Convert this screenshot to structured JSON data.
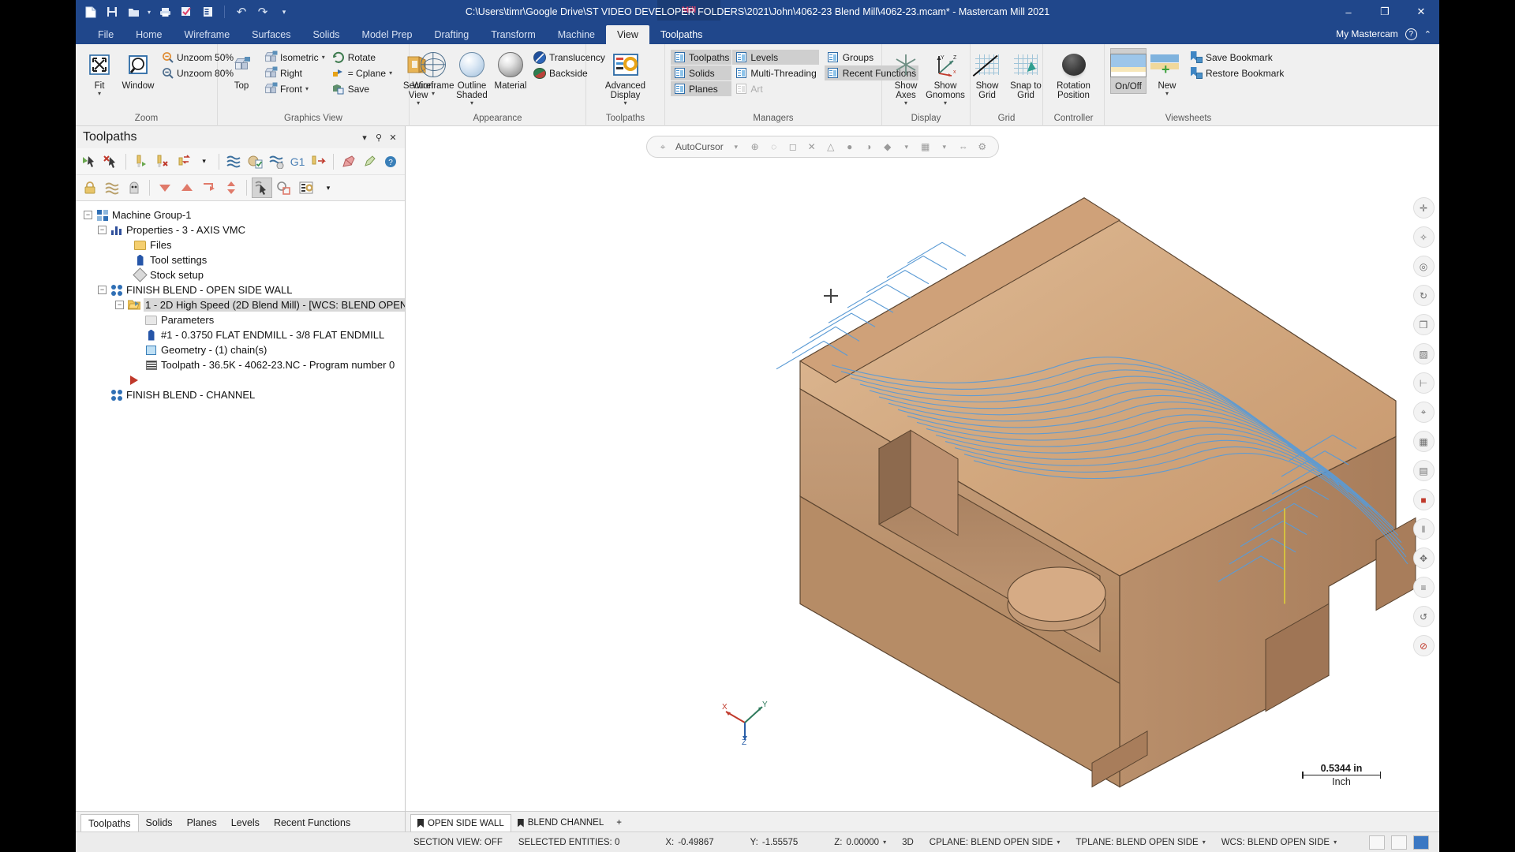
{
  "window": {
    "title": "C:\\Users\\timr\\Google Drive\\ST VIDEO DEVELOPER FOLDERS\\2021\\John\\4062-23 Blend Mill\\4062-23.mcam* - Mastercam Mill 2021",
    "product_badge": "Mill",
    "minimize": "–",
    "maximize": "❐",
    "close": "✕"
  },
  "quick_access": [
    {
      "name": "new-icon",
      "glyph": "❐"
    },
    {
      "name": "save-icon",
      "glyph": "὚B"
    },
    {
      "name": "open-icon",
      "glyph": "Ὄ1"
    },
    {
      "name": "print-icon",
      "glyph": "⎙"
    },
    {
      "name": "print-preview-icon",
      "glyph": "☑"
    },
    {
      "name": "import-icon",
      "glyph": "☰"
    },
    {
      "name": "undo-icon",
      "glyph": "↶"
    },
    {
      "name": "redo-icon",
      "glyph": "↷"
    },
    {
      "name": "customize-qat-icon",
      "glyph": "▾"
    }
  ],
  "ribbon": {
    "tabs": [
      "File",
      "Home",
      "Wireframe",
      "Surfaces",
      "Solids",
      "Model Prep",
      "Drafting",
      "Transform",
      "Machine",
      "View",
      "Toolpaths"
    ],
    "active_tab": "View",
    "my_mastercam": "My Mastercam",
    "help_glyph": "?",
    "collapse_glyph": "⌃",
    "groups": [
      {
        "label": "Zoom",
        "buttons": [
          {
            "name": "fit-button",
            "label": "Fit",
            "has_caret": true
          },
          {
            "name": "window-zoom-button",
            "label": "Window",
            "has_caret": false
          }
        ],
        "items": [
          {
            "name": "unzoom-50-button",
            "label": "Unzoom 50%"
          },
          {
            "name": "unzoom-80-button",
            "label": "Unzoom 80%"
          }
        ]
      },
      {
        "label": "Graphics View",
        "buttons": [
          {
            "name": "top-view-button",
            "label": "Top",
            "has_caret": false
          },
          {
            "name": "section-view-button",
            "label": "Section View",
            "has_caret": true
          }
        ],
        "col1": [
          {
            "name": "isometric-view-item",
            "label": "Isometric",
            "caret": true
          },
          {
            "name": "right-view-item",
            "label": "Right",
            "caret": false
          },
          {
            "name": "front-view-item",
            "label": "Front",
            "caret": true
          }
        ],
        "col2": [
          {
            "name": "rotate-item",
            "label": "Rotate",
            "caret": false
          },
          {
            "name": "equals-cplane-item",
            "label": "= Cplane",
            "caret": true
          },
          {
            "name": "save-view-item",
            "label": "Save",
            "caret": false
          }
        ]
      },
      {
        "label": "Appearance",
        "buttons": [
          {
            "name": "wireframe-button",
            "label": "Wireframe",
            "has_caret": true
          },
          {
            "name": "outline-shaded-button",
            "label": "Outline Shaded",
            "has_caret": true
          },
          {
            "name": "material-button",
            "label": "Material",
            "has_caret": false
          }
        ],
        "items": [
          {
            "name": "translucency-item",
            "label": "Translucency"
          },
          {
            "name": "backside-item",
            "label": "Backside"
          }
        ],
        "dialog_launcher": "⤵"
      },
      {
        "label": "Toolpaths",
        "buttons": [
          {
            "name": "advanced-display-button",
            "label": "Advanced Display",
            "has_caret": true
          }
        ],
        "dialog_launcher": "⤵"
      },
      {
        "label": "Managers",
        "col1": [
          {
            "name": "manager-toolpaths-item",
            "label": "Toolpaths",
            "active": true
          },
          {
            "name": "manager-solids-item",
            "label": "Solids",
            "active": true
          },
          {
            "name": "manager-planes-item",
            "label": "Planes",
            "active": true
          }
        ],
        "col2": [
          {
            "name": "manager-levels-item",
            "label": "Levels",
            "active": true
          },
          {
            "name": "manager-multi-threading-item",
            "label": "Multi-Threading",
            "active": false
          },
          {
            "name": "manager-art-item",
            "label": "Art",
            "active": false,
            "disabled": true
          }
        ],
        "col3": [
          {
            "name": "manager-groups-item",
            "label": "Groups",
            "active": false
          },
          {
            "name": "manager-recent-functions-item",
            "label": "Recent Functions",
            "active": true
          }
        ]
      },
      {
        "label": "Display",
        "buttons": [
          {
            "name": "show-axes-button",
            "label": "Show Axes",
            "has_caret": true
          },
          {
            "name": "show-gnomons-button",
            "label": "Show Gnomons",
            "has_caret": true
          }
        ]
      },
      {
        "label": "Grid",
        "buttons": [
          {
            "name": "show-grid-button",
            "label": "Show Grid",
            "has_caret": false
          },
          {
            "name": "snap-to-grid-button",
            "label": "Snap to Grid",
            "has_caret": false
          }
        ]
      },
      {
        "label": "Controller",
        "buttons": [
          {
            "name": "rotation-position-button",
            "label": "Rotation Position",
            "has_caret": false
          }
        ]
      },
      {
        "label": "Viewsheets",
        "buttons": [
          {
            "name": "viewsheets-onoff-button",
            "label": "On/Off",
            "has_caret": false
          },
          {
            "name": "new-viewsheet-button",
            "label": "New",
            "has_caret": true
          }
        ],
        "items": [
          {
            "name": "save-bookmark-item",
            "label": "Save Bookmark"
          },
          {
            "name": "restore-bookmark-item",
            "label": "Restore Bookmark"
          }
        ],
        "dialog_launcher": "⤵"
      }
    ]
  },
  "toolpaths_panel": {
    "title": "Toolpaths",
    "header_buttons": [
      {
        "name": "panel-dropdown-icon",
        "glyph": "▾"
      },
      {
        "name": "panel-pin-icon",
        "glyph": "⚑"
      },
      {
        "name": "panel-close-icon",
        "glyph": "✕"
      }
    ],
    "toolbar_row1": [
      {
        "name": "select-all-operations-icon",
        "glyph": "➤"
      },
      {
        "name": "deselect-all-operations-icon",
        "glyph": "✖"
      },
      {
        "name": "regenerate-selected-icon",
        "glyph": "▶"
      },
      {
        "name": "regenerate-invalid-icon",
        "glyph": "✖"
      },
      {
        "name": "regenerate-dirty-icon",
        "glyph": "↻"
      },
      {
        "name": "regenerate-options-caret-icon",
        "glyph": "▾"
      },
      {
        "name": "backplot-icon",
        "glyph": "≈"
      },
      {
        "name": "verify-icon",
        "glyph": "◔"
      },
      {
        "name": "simulate-icon",
        "glyph": "≈"
      },
      {
        "name": "g1-post-icon",
        "glyph": "G1"
      },
      {
        "name": "post-selected-icon",
        "glyph": "➡"
      },
      {
        "name": "high-feed-icon",
        "glyph": "✎"
      },
      {
        "name": "help-icon",
        "glyph": "?"
      }
    ],
    "toolbar_row2": [
      {
        "name": "lock-icon",
        "glyph": "ὑ2"
      },
      {
        "name": "toggle-posting-icon",
        "glyph": "≈"
      },
      {
        "name": "toggle-display-icon",
        "glyph": "●"
      },
      {
        "name": "move-down-icon",
        "glyph": "▼"
      },
      {
        "name": "move-up-icon",
        "glyph": "▲"
      },
      {
        "name": "insert-arrow-icon",
        "glyph": "↳"
      },
      {
        "name": "move-insert-arrow-icon",
        "glyph": "↕"
      },
      {
        "name": "only-selected-icon",
        "glyph": "↖"
      },
      {
        "name": "single-select-icon",
        "glyph": "○"
      },
      {
        "name": "toolpath-options-icon",
        "glyph": "☰"
      },
      {
        "name": "options-caret-icon",
        "glyph": "▾"
      }
    ],
    "tree": [
      {
        "name": "tree-machine-group",
        "label": "Machine Group-1",
        "indent": 0,
        "icon": "machine-group-icon",
        "expander": "-"
      },
      {
        "name": "tree-properties",
        "label": "Properties - 3 - AXIS VMC",
        "indent": 1,
        "icon": "properties-icon",
        "expander": "-"
      },
      {
        "name": "tree-files",
        "label": "Files",
        "indent": 2,
        "icon": "files-folder-icon",
        "expander": ""
      },
      {
        "name": "tree-tool-settings",
        "label": "Tool settings",
        "indent": 2,
        "icon": "tool-settings-icon",
        "expander": ""
      },
      {
        "name": "tree-stock-setup",
        "label": "Stock setup",
        "indent": 2,
        "icon": "stock-setup-icon",
        "expander": ""
      },
      {
        "name": "tree-toolpath-group-open-side-wall",
        "label": "FINISH BLEND - OPEN SIDE WALL",
        "indent": 1,
        "icon": "toolpath-group-icon",
        "expander": "-"
      },
      {
        "name": "tree-operation-1",
        "label": "1 - 2D High Speed (2D Blend Mill) - [WCS: BLEND OPEN",
        "indent": 2,
        "icon": "operation-folder-icon",
        "expander": "-",
        "selected": true
      },
      {
        "name": "tree-parameters",
        "label": "Parameters",
        "indent": 3,
        "icon": "parameters-icon",
        "expander": ""
      },
      {
        "name": "tree-tool",
        "label": "#1 - 0.3750 FLAT ENDMILL - 3/8 FLAT ENDMILL",
        "indent": 3,
        "icon": "tool-icon",
        "expander": ""
      },
      {
        "name": "tree-geometry",
        "label": "Geometry - (1) chain(s)",
        "indent": 3,
        "icon": "geometry-icon",
        "expander": ""
      },
      {
        "name": "tree-toolpath-nc",
        "label": "Toolpath - 36.5K - 4062-23.NC - Program number 0",
        "indent": 3,
        "icon": "nc-file-icon",
        "expander": ""
      },
      {
        "name": "tree-insert-arrow",
        "label": "",
        "indent": 2,
        "icon": "insert-arrow-icon",
        "expander": ""
      },
      {
        "name": "tree-toolpath-group-channel",
        "label": "FINISH BLEND - CHANNEL",
        "indent": 1,
        "icon": "toolpath-group-icon",
        "expander": ""
      }
    ],
    "bottom_tabs": [
      {
        "name": "panel-tab-toolpaths",
        "label": "Toolpaths",
        "active": true
      },
      {
        "name": "panel-tab-solids",
        "label": "Solids",
        "active": false
      },
      {
        "name": "panel-tab-planes",
        "label": "Planes",
        "active": false
      },
      {
        "name": "panel-tab-levels",
        "label": "Levels",
        "active": false
      },
      {
        "name": "panel-tab-recent-functions",
        "label": "Recent Functions",
        "active": false
      }
    ]
  },
  "graphics": {
    "autocursor_label": "AutoCursor",
    "autocursor_icons": [
      {
        "name": "autocursor-target-icon",
        "glyph": "⌖"
      },
      {
        "name": "autocursor-caret-icon",
        "glyph": "▾"
      },
      {
        "name": "autocursor-origin-icon",
        "glyph": "⊕"
      },
      {
        "name": "autocursor-arc-center-icon",
        "glyph": "◌"
      },
      {
        "name": "autocursor-endpoint-icon",
        "glyph": "◻"
      },
      {
        "name": "autocursor-intersection-icon",
        "glyph": "✕"
      },
      {
        "name": "autocursor-midpoint-icon",
        "glyph": "△"
      },
      {
        "name": "autocursor-point-icon",
        "glyph": "●"
      },
      {
        "name": "autocursor-quadrant-icon",
        "glyph": "◑"
      },
      {
        "name": "autocursor-nearest-icon",
        "glyph": "◆"
      },
      {
        "name": "autocursor-grid-icon",
        "glyph": "▦"
      },
      {
        "name": "autocursor-grid-caret-icon",
        "glyph": "▾"
      },
      {
        "name": "autocursor-relative-icon",
        "glyph": "⇔"
      },
      {
        "name": "autocursor-settings-icon",
        "glyph": "⚙"
      }
    ],
    "scale_value": "0.5344 in",
    "scale_unit": "Inch",
    "axis_labels": {
      "x": "X",
      "y": "Y",
      "z": "Z"
    },
    "right_toolbar": [
      {
        "name": "fit-view-icon",
        "glyph": "✥"
      },
      {
        "name": "wireframe-display-icon",
        "glyph": "⚙"
      },
      {
        "name": "shaded-display-icon",
        "glyph": "○"
      },
      {
        "name": "rotate-view-icon",
        "glyph": "↻"
      },
      {
        "name": "isometric-view-icon",
        "glyph": "❑"
      },
      {
        "name": "section-view-icon",
        "glyph": "▧"
      },
      {
        "name": "measure-icon",
        "glyph": "⊢"
      },
      {
        "name": "zoom-target-icon",
        "glyph": "⌖"
      },
      {
        "name": "blank-entities-icon",
        "glyph": "▦"
      },
      {
        "name": "level-display-icon",
        "glyph": "▤"
      },
      {
        "name": "color-icon",
        "glyph": "■"
      },
      {
        "name": "toolpath-display-icon",
        "glyph": "‖"
      },
      {
        "name": "gnomon-icon",
        "glyph": "✣"
      },
      {
        "name": "layers-icon",
        "glyph": "≡"
      },
      {
        "name": "undo-view-icon",
        "glyph": "↺"
      },
      {
        "name": "clear-colors-icon",
        "glyph": "⊘"
      }
    ],
    "viewsheet_tabs": [
      {
        "name": "viewsheet-tab-open-side-wall",
        "label": "OPEN SIDE WALL",
        "active": true
      },
      {
        "name": "viewsheet-tab-blend-channel",
        "label": "BLEND CHANNEL",
        "active": false
      }
    ],
    "add_viewsheet": "+"
  },
  "status_bar": {
    "section_view": "SECTION VIEW: OFF",
    "selected_entities": "SELECTED ENTITIES: 0",
    "x_label": "X:",
    "x_value": "-0.49867",
    "y_label": "Y:",
    "y_value": "-1.55575",
    "z_label": "Z:",
    "z_value": "0.00000",
    "z_caret": "▾",
    "mode": "3D",
    "cplane": "CPLANE: BLEND OPEN SIDE",
    "cplane_caret": "▾",
    "tplane": "TPLANE: BLEND OPEN SIDE",
    "tplane_caret": "▾",
    "wcs": "WCS: BLEND OPEN SIDE",
    "wcs_caret": "▾",
    "nav_prev": "◀",
    "nav_next": "▶"
  }
}
